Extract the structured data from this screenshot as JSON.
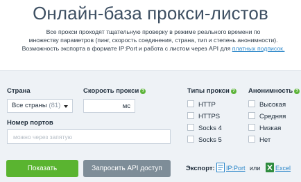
{
  "title": "Онлайн-база прокси-листов",
  "intro": {
    "line1": "Все прокси проходят тщательную проверку в режиме реального времени по",
    "line2": "множеству параметров (пинг, скорость соединения, страна, тип и степень анонимности).",
    "line3": "Возможность экспорта в формате IP:Port и работа с листом через API для",
    "link": "платных подписок."
  },
  "filters": {
    "country": {
      "label": "Страна",
      "value": "Все страны",
      "count": "(81)"
    },
    "speed": {
      "label": "Скорость прокси",
      "unit": "мс",
      "value": ""
    },
    "ports": {
      "label": "Номер портов",
      "placeholder": "можно через запятую",
      "value": ""
    },
    "types": {
      "label": "Типы прокси",
      "items": [
        "HTTP",
        "HTTPS",
        "Socks 4",
        "Socks 5"
      ]
    },
    "anonymity": {
      "label": "Анонимность",
      "items": [
        "Высокая",
        "Средняя",
        "Низкая",
        "Нет"
      ]
    }
  },
  "help_icon": "?",
  "buttons": {
    "show": "Показать",
    "api": "Запросить API доступ"
  },
  "export": {
    "label": "Экспорт:",
    "ipport": "IP:Port",
    "or": "или",
    "excel": "Excel"
  },
  "colors": {
    "accent_green": "#5ab430",
    "button_gray": "#7e8d98",
    "link_blue": "#2a86c9",
    "panel_bg": "#eef2f6"
  },
  "icons": [
    "help-icon",
    "chevron-down-icon",
    "document-icon",
    "excel-icon"
  ]
}
